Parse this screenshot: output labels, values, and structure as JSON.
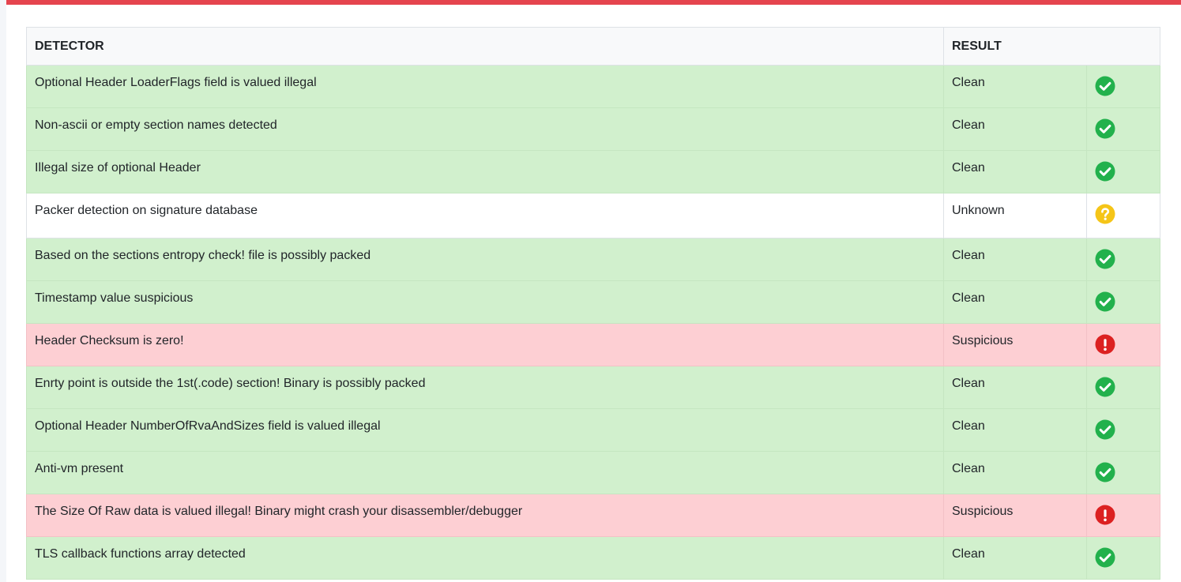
{
  "table": {
    "headers": {
      "detector": "DETECTOR",
      "result": "RESULT"
    },
    "rows": [
      {
        "detector": "Optional Header LoaderFlags field is valued illegal",
        "result": "Clean",
        "status": "clean"
      },
      {
        "detector": "Non-ascii or empty section names detected",
        "result": "Clean",
        "status": "clean"
      },
      {
        "detector": "Illegal size of optional Header",
        "result": "Clean",
        "status": "clean"
      },
      {
        "detector": "Packer detection on signature database",
        "result": "Unknown",
        "status": "unknown"
      },
      {
        "detector": "Based on the sections entropy check! file is possibly packed",
        "result": "Clean",
        "status": "clean"
      },
      {
        "detector": "Timestamp value suspicious",
        "result": "Clean",
        "status": "clean"
      },
      {
        "detector": "Header Checksum is zero!",
        "result": "Suspicious",
        "status": "suspicious"
      },
      {
        "detector": "Enrty point is outside the 1st(.code) section! Binary is possibly packed",
        "result": "Clean",
        "status": "clean"
      },
      {
        "detector": "Optional Header NumberOfRvaAndSizes field is valued illegal",
        "result": "Clean",
        "status": "clean"
      },
      {
        "detector": "Anti-vm present",
        "result": "Clean",
        "status": "clean"
      },
      {
        "detector": "The Size Of Raw data is valued illegal! Binary might crash your disassembler/debugger",
        "result": "Suspicious",
        "status": "suspicious"
      },
      {
        "detector": "TLS callback functions array detected",
        "result": "Clean",
        "status": "clean"
      }
    ]
  },
  "icons": {
    "clean": "check-circle-icon",
    "unknown": "question-circle-icon",
    "suspicious": "exclamation-circle-icon"
  },
  "colors": {
    "accent_border": "#e5444e",
    "clean_row": "#d1f0cd",
    "suspicious_row": "#fdcfd3",
    "clean_icon": "#22b14c",
    "unknown_icon": "#f5c518",
    "suspicious_icon": "#dc2121"
  }
}
